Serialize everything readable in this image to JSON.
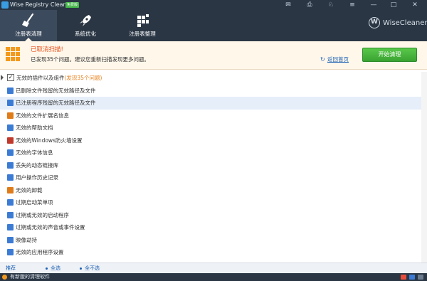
{
  "window": {
    "title": "Wise Registry Cleaner X",
    "badge": "免费版",
    "controls": [
      "✉",
      "⎙",
      "♘",
      "≡",
      "—",
      "□",
      "✕"
    ]
  },
  "nav": {
    "tabs": [
      {
        "label": "注册表清理",
        "icon": "broom-icon",
        "active": true
      },
      {
        "label": "系统优化",
        "icon": "rocket-icon",
        "active": false
      },
      {
        "label": "注册表整理",
        "icon": "blocks-icon",
        "active": false
      }
    ]
  },
  "brand": {
    "logo_letter": "W",
    "name": "WiseCleaner"
  },
  "banner": {
    "title": "已取消扫描!",
    "subtitle": "已发现35个问题。建议您重新扫描发现更多问题。",
    "back_link": "返回首页",
    "start_button": "开始清理"
  },
  "list": {
    "header": {
      "label": "无效的插件以及组件",
      "count_text": "(发现35个问题)",
      "checked": true
    },
    "items": [
      {
        "label": "已删除文件残留的无效路径及文件",
        "icon": "file-icon",
        "color": "#3b7bd4"
      },
      {
        "label": "已注册程序残留的无效路径及文件",
        "icon": "app-icon",
        "color": "#3b7bd4",
        "selected": true
      },
      {
        "label": "无效的文件扩展名信息",
        "icon": "extension-icon",
        "color": "#e07b1a"
      },
      {
        "label": "无效的帮助文档",
        "icon": "help-doc-icon",
        "color": "#3b7bd4"
      },
      {
        "label": "无效的Windows防火墙设置",
        "icon": "firewall-icon",
        "color": "#c0392b"
      },
      {
        "label": "无效的字体信息",
        "icon": "font-icon",
        "color": "#3b7bd4"
      },
      {
        "label": "丢失的动态链接库",
        "icon": "dll-icon",
        "color": "#3b7bd4"
      },
      {
        "label": "用户操作历史记录",
        "icon": "history-icon",
        "color": "#3b7bd4"
      },
      {
        "label": "无效的卸载",
        "icon": "uninstall-icon",
        "color": "#e07b1a"
      },
      {
        "label": "过期启动菜单项",
        "icon": "start-menu-icon",
        "color": "#3b7bd4"
      },
      {
        "label": "过期或无效的启动程序",
        "icon": "startup-icon",
        "color": "#3b7bd4"
      },
      {
        "label": "过期或无效的声音或事件设置",
        "icon": "sound-icon",
        "color": "#3b7bd4"
      },
      {
        "label": "映像劫持",
        "icon": "hijack-icon",
        "color": "#3b7bd4"
      },
      {
        "label": "无效的应用程序设置",
        "icon": "settings-icon",
        "color": "#3b7bd4"
      }
    ]
  },
  "footer": {
    "recommend": "推荐",
    "select_all": "全选",
    "select_none": "全不选"
  },
  "statusbar": {
    "text": "有新版的清理软件"
  }
}
